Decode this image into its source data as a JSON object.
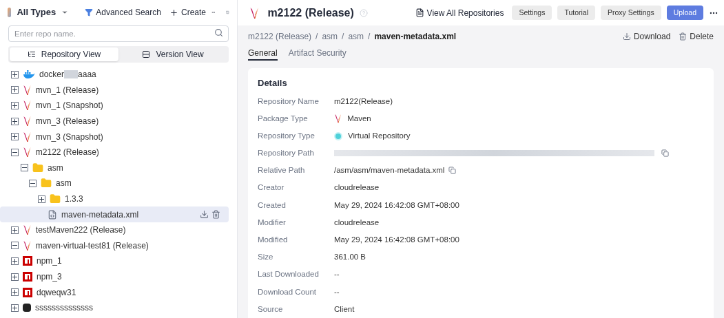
{
  "sidebar": {
    "type_filter": "All Types",
    "advanced_search": "Advanced Search",
    "create": "Create",
    "search": {
      "placeholder": "Enter repo name."
    },
    "views": [
      {
        "label": "Repository View",
        "selected": true
      },
      {
        "label": "Version View",
        "selected": false
      }
    ],
    "tree": [
      {
        "kind": "docker",
        "label": "docker",
        "label_suffix": "aaaa",
        "expanded": false,
        "selected": false
      },
      {
        "kind": "maven",
        "label": "mvn_1 (Release)",
        "expanded": false,
        "selected": false
      },
      {
        "kind": "maven",
        "label": "mvn_1 (Snapshot)",
        "expanded": false,
        "selected": false
      },
      {
        "kind": "maven",
        "label": "mvn_3 (Release)",
        "expanded": false,
        "selected": false
      },
      {
        "kind": "maven",
        "label": "mvn_3 (Snapshot)",
        "expanded": false,
        "selected": false
      },
      {
        "kind": "maven",
        "label": "m2122 (Release)",
        "expanded": true,
        "selected": false,
        "children": [
          {
            "kind": "folder",
            "label": "asm",
            "expanded": true,
            "selected": false,
            "children": [
              {
                "kind": "folder",
                "label": "asm",
                "expanded": true,
                "selected": false,
                "children": [
                  {
                    "kind": "folder",
                    "label": "1.3.3",
                    "expanded": false,
                    "selected": false
                  },
                  {
                    "kind": "file",
                    "label": "maven-metadata.xml",
                    "selected": true
                  }
                ]
              }
            ]
          }
        ]
      },
      {
        "kind": "maven",
        "label": "testMaven222 (Release)",
        "expanded": false,
        "selected": false
      },
      {
        "kind": "maven",
        "label": "maven-virtual-test81 (Release)",
        "expanded": true,
        "selected": false
      },
      {
        "kind": "npm",
        "label": "npm_1",
        "expanded": false,
        "selected": false
      },
      {
        "kind": "npm",
        "label": "npm_3",
        "expanded": false,
        "selected": false
      },
      {
        "kind": "npm",
        "label": "dqweqw31",
        "expanded": false,
        "selected": false
      },
      {
        "kind": "generic",
        "label": "ssssssssssssss",
        "expanded": false,
        "selected": false
      }
    ]
  },
  "header": {
    "title": "m2122 (Release)",
    "view_all": "View All Repositories",
    "buttons": [
      {
        "label": "Settings",
        "kind": "secondary"
      },
      {
        "label": "Tutorial",
        "kind": "secondary"
      },
      {
        "label": "Proxy Settings",
        "kind": "secondary"
      },
      {
        "label": "Upload",
        "kind": "primary"
      }
    ]
  },
  "breadcrumb": {
    "items": [
      "m2122 (Release)",
      "asm",
      "asm",
      "maven-metadata.xml"
    ],
    "separators": [
      "/",
      "/",
      "/"
    ]
  },
  "actions": [
    "Download",
    "Delete"
  ],
  "tabs": [
    {
      "label": "General",
      "selected": true
    },
    {
      "label": "Artifact Security",
      "selected": false
    }
  ],
  "details": {
    "title": "Details",
    "rows": [
      {
        "label": "Repository Name",
        "kind": "text",
        "value": "m2122(Release)"
      },
      {
        "label": "Package Type",
        "kind": "maven",
        "value": "Maven"
      },
      {
        "label": "Repository Type",
        "kind": "virtual",
        "value": "Virtual Repository"
      },
      {
        "label": "Repository Path",
        "kind": "redacted"
      },
      {
        "label": "Relative Path",
        "kind": "copy",
        "value": "/asm/asm/maven-metadata.xml"
      },
      {
        "label": "Creator",
        "kind": "text",
        "value": "cloudrelease"
      },
      {
        "label": "Created",
        "kind": "text",
        "value": "May 29, 2024 16:42:08 GMT+08:00"
      },
      {
        "label": "Modifier",
        "kind": "text",
        "value": "cloudrelease"
      },
      {
        "label": "Modified",
        "kind": "text",
        "value": "May 29, 2024 16:42:08 GMT+08:00"
      },
      {
        "label": "Size",
        "kind": "text",
        "value": "361.00 B"
      },
      {
        "label": "Last Downloaded",
        "kind": "text",
        "value": "--"
      },
      {
        "label": "Download Count",
        "kind": "text",
        "value": "--"
      },
      {
        "label": "Source",
        "kind": "text",
        "value": "Client"
      }
    ]
  }
}
